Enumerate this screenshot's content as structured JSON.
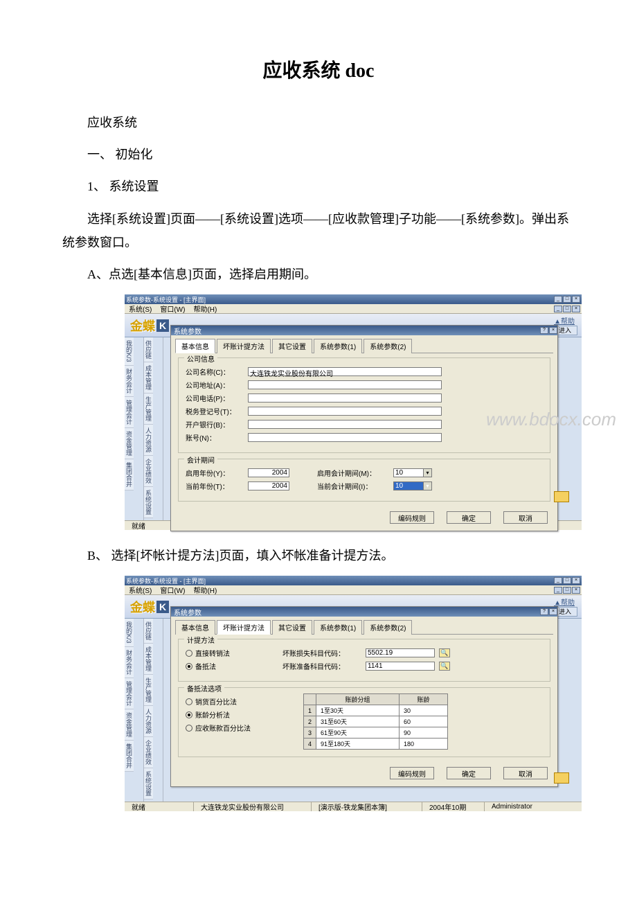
{
  "doc": {
    "title": "应收系统 doc",
    "p1": "应收系统",
    "p2": "一、 初始化",
    "p3": "1、 系统设置",
    "p4": "选择[系统设置]页面——[系统设置]选项——[应收款管理]子功能——[系统参数]。弹出系统参数窗口。",
    "p5": "A、点选[基本信息]页面，选择启用期间。",
    "p6": "B、 选择[坏帐计提方法]页面，填入坏帐准备计提方法。"
  },
  "window": {
    "title": "系统参数-系统设置 - [主界面]",
    "menus": [
      "系统(S)",
      "窗口(W)",
      "帮助(H)"
    ],
    "logo_text": "金蝶",
    "help": "▲帮助",
    "enter": "进入",
    "status_ready": "就绪",
    "status_company": "大连铁龙实业股份有限公司",
    "status_db": "[演示版-铁龙集团本簿]",
    "status_period": "2004年10期",
    "status_user": "Administrator",
    "sidebar1": [
      "供应链",
      "成本管理",
      "生产管理",
      "人力资源",
      "企业绩效",
      "系统设置"
    ],
    "sidebar2": [
      "我的K/3",
      "财务会计",
      "管理会计",
      "资金管理",
      "集团合并"
    ]
  },
  "dialog": {
    "title": "系统参数",
    "tabs": [
      "基本信息",
      "坏账计提方法",
      "其它设置",
      "系统参数(1)",
      "系统参数(2)"
    ],
    "btn_encode": "编码规则",
    "btn_ok": "确定",
    "btn_cancel": "取消"
  },
  "shotA": {
    "group_company": "公司信息",
    "company_name_lbl": "公司名称(C)：",
    "company_name_val": "大连铁龙实业股份有限公司",
    "address_lbl": "公司地址(A)：",
    "phone_lbl": "公司电话(P)：",
    "tax_lbl": "税务登记号(T)：",
    "bank_lbl": "开户银行(B)：",
    "acct_lbl": "账号(N)：",
    "group_period": "会计期间",
    "start_year_lbl": "启用年份(Y)：",
    "start_year_val": "2004",
    "curr_year_lbl": "当前年份(T)：",
    "curr_year_val": "2004",
    "start_period_lbl": "启用会计期间(M)：",
    "start_period_val": "10",
    "curr_period_lbl": "当前会计期间(I)：",
    "curr_period_val": "10"
  },
  "shotB": {
    "group_method": "计提方法",
    "direct_lbl": "直接转销法",
    "allowance_lbl": "备抵法",
    "loss_lbl": "坏账损失科目代码：",
    "loss_val": "5502.19",
    "reserve_lbl": "坏账准备科目代码：",
    "reserve_val": "1141",
    "group_options": "备抵法选项",
    "opt_sales": "销货百分比法",
    "opt_aging": "账龄分析法",
    "opt_balance": "应收账款百分比法",
    "col_range": "账龄分组",
    "col_age": "账龄",
    "rows": [
      {
        "range": "1至30天",
        "age": "30"
      },
      {
        "range": "31至60天",
        "age": "60"
      },
      {
        "range": "61至90天",
        "age": "90"
      },
      {
        "range": "91至180天",
        "age": "180"
      }
    ]
  },
  "watermark": "www.bdocx.com"
}
